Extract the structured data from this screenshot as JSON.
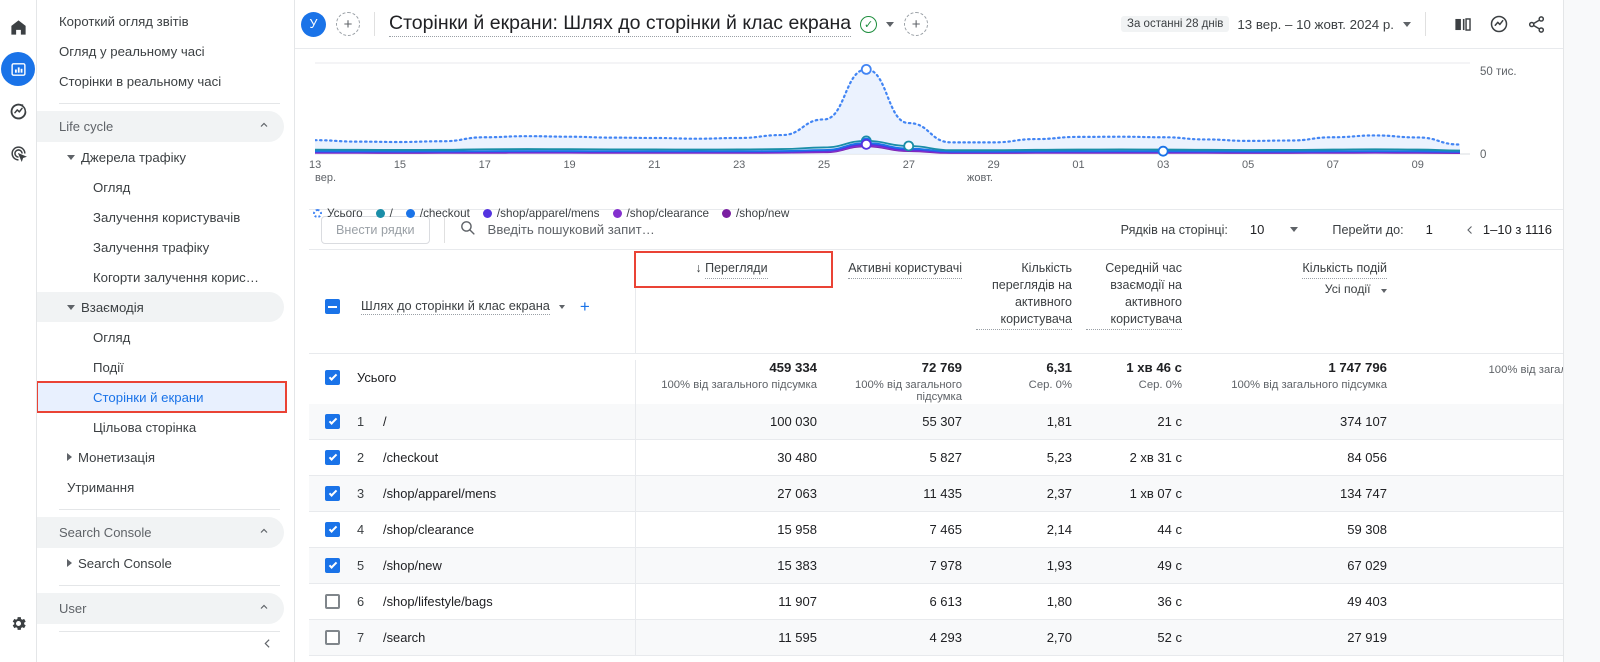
{
  "rail": {
    "items": [
      {
        "name": "home-icon",
        "label": "Home"
      },
      {
        "name": "reports-icon",
        "label": "Reports"
      },
      {
        "name": "explore-icon",
        "label": "Explore"
      },
      {
        "name": "advertising-icon",
        "label": "Advertising"
      }
    ],
    "settings_label": "Адміністратор"
  },
  "sidebar": {
    "top_items": [
      {
        "label": "Короткий огляд звітів"
      },
      {
        "label": "Огляд у реальному часі"
      },
      {
        "label": "Сторінки в реальному часі"
      }
    ],
    "lifecycle_section": "Life cycle",
    "groups": [
      {
        "label": "Джерела трафіку",
        "expanded": true,
        "children": [
          {
            "label": "Огляд"
          },
          {
            "label": "Залучення користувачів"
          },
          {
            "label": "Залучення трафіку"
          },
          {
            "label": "Когорти залучення корис…"
          }
        ]
      },
      {
        "label": "Взаємодія",
        "expanded": true,
        "children": [
          {
            "label": "Огляд"
          },
          {
            "label": "Події"
          },
          {
            "label": "Сторінки й екрани",
            "selected": true,
            "highlighted": true
          },
          {
            "label": "Цільова сторінка"
          }
        ]
      },
      {
        "label": "Монетизація",
        "expanded": false,
        "children": []
      }
    ],
    "retention_label": "Утримання",
    "search_console_section": "Search Console",
    "search_console_item": "Search Console",
    "user_section": "User",
    "collapse_label": "Згорнути"
  },
  "header": {
    "account_initial": "У",
    "add_comparison_label": "+",
    "title": "Сторінки й екрани: Шлях до сторінки й клас екрана",
    "insights_check": "✓",
    "title_dropdown": "▾",
    "add_button": "+",
    "date_chip": "За останні 28 днів",
    "date_range": "13 вер. – 10 жовт. 2024 р.",
    "date_caret": "▾",
    "icons": [
      {
        "name": "compare-icon",
        "label": "Порівняти"
      },
      {
        "name": "insights-icon",
        "label": "Статистика"
      },
      {
        "name": "share-icon",
        "label": "Поділитися"
      },
      {
        "name": "trends-icon",
        "label": "Тренди"
      }
    ]
  },
  "chart_data": {
    "type": "line",
    "title": "",
    "xlabel": "",
    "ylabel": "",
    "ylim": [
      0,
      50000
    ],
    "ytick_labels": [
      "50 тис.",
      "0"
    ],
    "ytick_values": [
      50000,
      0
    ],
    "grid": true,
    "legend_position": "bottom",
    "x_axis_month_labels": [
      "вер.",
      "жовт."
    ],
    "x": [
      "13",
      "14",
      "15",
      "16",
      "17",
      "18",
      "19",
      "20",
      "21",
      "22",
      "23",
      "24",
      "25",
      "26",
      "27",
      "28",
      "29",
      "30",
      "01",
      "02",
      "03",
      "04",
      "05",
      "06",
      "07",
      "08",
      "09",
      "10"
    ],
    "xtick_labels": [
      "13",
      "15",
      "17",
      "19",
      "21",
      "23",
      "25",
      "27",
      "29",
      "01",
      "03",
      "05",
      "07",
      "09"
    ],
    "series": [
      {
        "name": "Усього",
        "color": "#4285f4",
        "style": "dotted-area",
        "values": [
          7600,
          6800,
          6600,
          7000,
          9200,
          9800,
          9500,
          9000,
          8800,
          8400,
          8800,
          10400,
          19000,
          46500,
          17000,
          6400,
          6400,
          8200,
          9400,
          9500,
          9200,
          8000,
          7200,
          7400,
          9200,
          10200,
          9100,
          5200
        ]
      },
      {
        "name": "/",
        "color": "#1a8ea8",
        "style": "solid",
        "values": [
          2400,
          2300,
          2250,
          2300,
          2600,
          2700,
          2650,
          2550,
          2500,
          2450,
          2500,
          2700,
          3600,
          7200,
          4400,
          2100,
          2100,
          2300,
          2450,
          2500,
          2450,
          2300,
          2200,
          2250,
          2450,
          2600,
          2450,
          1900
        ]
      },
      {
        "name": "/checkout",
        "color": "#1a73e8",
        "style": "solid",
        "values": [
          1500,
          1450,
          1420,
          1450,
          1600,
          1650,
          1620,
          1570,
          1540,
          1510,
          1540,
          1650,
          2200,
          6000,
          3000,
          1350,
          1350,
          1450,
          1540,
          1570,
          1540,
          1450,
          1400,
          1420,
          1540,
          1620,
          1540,
          1250
        ]
      },
      {
        "name": "/shop/apparel/mens",
        "color": "#5433e0",
        "style": "solid",
        "values": [
          1150,
          1100,
          1080,
          1100,
          1200,
          1250,
          1230,
          1190,
          1170,
          1150,
          1170,
          1250,
          1700,
          5300,
          2400,
          1020,
          1020,
          1100,
          1170,
          1190,
          1170,
          1100,
          1060,
          1080,
          1170,
          1230,
          1170,
          950
        ]
      },
      {
        "name": "/shop/clearance",
        "color": "#8430ce",
        "style": "solid",
        "values": [
          800,
          770,
          760,
          770,
          840,
          870,
          860,
          830,
          820,
          800,
          820,
          870,
          1200,
          4600,
          1900,
          710,
          710,
          770,
          820,
          830,
          820,
          770,
          740,
          760,
          820,
          860,
          820,
          660
        ]
      },
      {
        "name": "/shop/new",
        "color": "#7b1fa2",
        "style": "solid",
        "values": [
          620,
          600,
          590,
          600,
          650,
          680,
          670,
          650,
          640,
          620,
          640,
          680,
          950,
          4200,
          1600,
          550,
          550,
          600,
          640,
          650,
          640,
          600,
          580,
          590,
          640,
          670,
          640,
          510
        ]
      }
    ],
    "markers": [
      {
        "x": "26",
        "series": [
          "Усього",
          "/",
          "/checkout",
          "/shop/apparel/mens"
        ]
      },
      {
        "x": "27",
        "series": [
          "/"
        ]
      },
      {
        "x": "03",
        "series": [
          "/checkout"
        ]
      }
    ]
  },
  "toolbar": {
    "import_rows_label": "Внести рядки",
    "search_placeholder": "Введіть пошуковий запит…",
    "rows_per_page_label": "Рядків на сторінці:",
    "rows_per_page_value": "10",
    "goto_label": "Перейти до:",
    "goto_value": "1",
    "page_range": "1–10 з 1116",
    "prev_label": "‹",
    "next_label": "›"
  },
  "table": {
    "dimension_label": "Шлях до сторінки й клас екрана",
    "columns": [
      {
        "key": "views",
        "label": "Перегляди",
        "sorted": true,
        "sort_arrow": "↓",
        "highlighted": true
      },
      {
        "key": "users",
        "label": "Активні користувачі"
      },
      {
        "key": "vpu",
        "label": "Кількість переглядів на активного користувача"
      },
      {
        "key": "time",
        "label": "Середній час взаємодії на активного користувача"
      },
      {
        "key": "events",
        "label": "Кількість подій",
        "sub": "Усі події"
      },
      {
        "key": "revenue",
        "label": ""
      }
    ],
    "total_row": {
      "label": "Усього",
      "checked": true,
      "views": "459 334",
      "views_sub": "100% від загального підсумка",
      "users": "72 769",
      "users_sub": "100% від загального підсумка",
      "vpu": "6,31",
      "vpu_sub": "Сер. 0%",
      "time": "1 хв 46 с",
      "time_sub": "Сер. 0%",
      "events": "1 747 796",
      "events_sub": "100% від загального підсумка",
      "revenue": "",
      "revenue_sub": "100% від загал"
    },
    "rows": [
      {
        "n": "1",
        "label": "/",
        "checked": true,
        "views": "100 030",
        "users": "55 307",
        "vpu": "1,81",
        "time": "21 с",
        "events": "374 107"
      },
      {
        "n": "2",
        "label": "/checkout",
        "checked": true,
        "views": "30 480",
        "users": "5 827",
        "vpu": "5,23",
        "time": "2 хв 31 с",
        "events": "84 056"
      },
      {
        "n": "3",
        "label": "/shop/apparel/mens",
        "checked": true,
        "views": "27 063",
        "users": "11 435",
        "vpu": "2,37",
        "time": "1 хв 07 с",
        "events": "134 747"
      },
      {
        "n": "4",
        "label": "/shop/clearance",
        "checked": true,
        "views": "15 958",
        "users": "7 465",
        "vpu": "2,14",
        "time": "44 с",
        "events": "59 308"
      },
      {
        "n": "5",
        "label": "/shop/new",
        "checked": true,
        "views": "15 383",
        "users": "7 978",
        "vpu": "1,93",
        "time": "49 с",
        "events": "67 029"
      },
      {
        "n": "6",
        "label": "/shop/lifestyle/bags",
        "checked": false,
        "views": "11 907",
        "users": "6 613",
        "vpu": "1,80",
        "time": "36 с",
        "events": "49 403"
      },
      {
        "n": "7",
        "label": "/search",
        "checked": false,
        "views": "11 595",
        "users": "4 293",
        "vpu": "2,70",
        "time": "52 с",
        "events": "27 919"
      }
    ]
  }
}
